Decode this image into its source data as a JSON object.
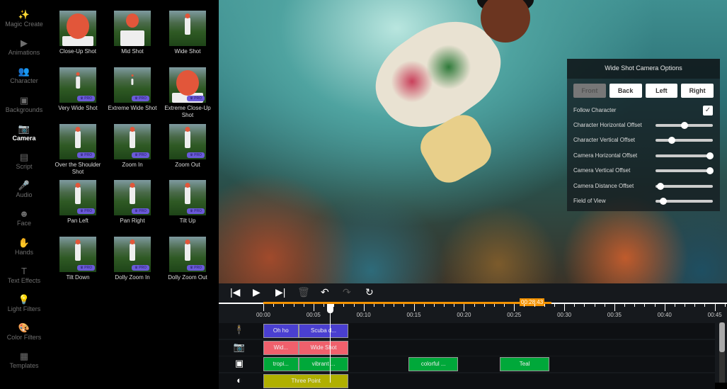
{
  "sidebar": {
    "items": [
      {
        "label": "Magic Create",
        "icon": "magic-wand-icon",
        "glyph": "✨"
      },
      {
        "label": "Animations",
        "icon": "play-icon",
        "glyph": "▶"
      },
      {
        "label": "Character",
        "icon": "character-icon",
        "glyph": "👥"
      },
      {
        "label": "Backgrounds",
        "icon": "background-icon",
        "glyph": "▣"
      },
      {
        "label": "Camera",
        "icon": "camera-icon",
        "glyph": "📷",
        "active": true
      },
      {
        "label": "Script",
        "icon": "script-icon",
        "glyph": "▤"
      },
      {
        "label": "Audio",
        "icon": "microphone-icon",
        "glyph": "🎤"
      },
      {
        "label": "Face",
        "icon": "face-icon",
        "glyph": "☻"
      },
      {
        "label": "Hands",
        "icon": "hand-icon",
        "glyph": "✋"
      },
      {
        "label": "Text Effects",
        "icon": "text-icon",
        "glyph": "T"
      },
      {
        "label": "Light Filters",
        "icon": "bulb-icon",
        "glyph": "💡"
      },
      {
        "label": "Color Filters",
        "icon": "palette-icon",
        "glyph": "🎨"
      },
      {
        "label": "Templates",
        "icon": "template-icon",
        "glyph": "▦"
      }
    ]
  },
  "shots": [
    {
      "label": "Close-Up Shot",
      "pro": false
    },
    {
      "label": "Mid Shot",
      "pro": false
    },
    {
      "label": "Wide Shot",
      "pro": false
    },
    {
      "label": "Very Wide Shot",
      "pro": true
    },
    {
      "label": "Extreme Wide Shot",
      "pro": true
    },
    {
      "label": "Extreme Close-Up Shot",
      "pro": true
    },
    {
      "label": "Over the Shoulder Shot",
      "pro": true
    },
    {
      "label": "Zoom In",
      "pro": true
    },
    {
      "label": "Zoom Out",
      "pro": true
    },
    {
      "label": "Pan Left",
      "pro": true
    },
    {
      "label": "Pan Right",
      "pro": true
    },
    {
      "label": "Tilt Up",
      "pro": true
    },
    {
      "label": "Tilt Down",
      "pro": true
    },
    {
      "label": "Dolly Zoom In",
      "pro": true
    },
    {
      "label": "Dolly Zoom Out",
      "pro": true
    }
  ],
  "pro_label": "♛ PRO",
  "panel": {
    "title": "Wide Shot Camera Options",
    "buttons": [
      "Front",
      "Back",
      "Left",
      "Right"
    ],
    "follow_label": "Follow Character",
    "follow_checked": true,
    "check_glyph": "✓",
    "sliders": [
      {
        "label": "Character Horizontal Offset",
        "value": 0.5
      },
      {
        "label": "Character Vertical Offset",
        "value": 0.28
      },
      {
        "label": "Camera Horizontal Offset",
        "value": 0.95
      },
      {
        "label": "Camera Vertical Offset",
        "value": 0.95
      },
      {
        "label": "Camera Distance Offset",
        "value": 0.09
      },
      {
        "label": "Field of View",
        "value": 0.14
      }
    ]
  },
  "timeline": {
    "controls": [
      {
        "icon": "skip-start-icon",
        "glyph": "|◀"
      },
      {
        "icon": "play-icon",
        "glyph": "▶"
      },
      {
        "icon": "skip-end-icon",
        "glyph": "▶|"
      },
      {
        "icon": "trash-icon",
        "glyph": "🗑"
      },
      {
        "icon": "undo-icon",
        "glyph": "↶"
      },
      {
        "icon": "redo-icon",
        "glyph": "↷"
      },
      {
        "icon": "refresh-icon",
        "glyph": "↻"
      }
    ],
    "duration": "00:28:43",
    "duration_seconds": 28.7,
    "playhead_seconds": 6.6,
    "ticks": [
      "00:00",
      "00:05",
      "00:10",
      "00:15",
      "00:20",
      "00:25",
      "00:30",
      "00:35",
      "00:40",
      "00:45"
    ],
    "tracks": [
      {
        "icon": "person-icon",
        "glyph": "🕴",
        "color": "#4a3fd0",
        "clips": [
          {
            "label": "Oh ho",
            "start": 0,
            "end": 3.5
          },
          {
            "label": "Scuba d...",
            "start": 3.5,
            "end": 8.5
          }
        ]
      },
      {
        "icon": "camera-icon",
        "glyph": "📷",
        "color": "#f0606c",
        "clips": [
          {
            "label": "Wid...",
            "start": 0,
            "end": 3.5
          },
          {
            "label": "Wide Shot",
            "start": 3.5,
            "end": 8.5
          }
        ]
      },
      {
        "icon": "background-icon",
        "glyph": "▣",
        "color": "#00a83a",
        "clips": [
          {
            "label": "tropi...",
            "start": 0,
            "end": 3.5
          },
          {
            "label": "vibrant ...",
            "start": 3.5,
            "end": 8.5
          },
          {
            "label": "colorful ...",
            "start": 14.5,
            "end": 19.4
          },
          {
            "label": "Teal",
            "start": 23.6,
            "end": 28.5
          }
        ]
      },
      {
        "icon": "light-icon",
        "glyph": "◐",
        "color": "#b0b000",
        "clips": [
          {
            "label": "Three Point",
            "start": 0,
            "end": 8.5
          }
        ]
      }
    ]
  }
}
